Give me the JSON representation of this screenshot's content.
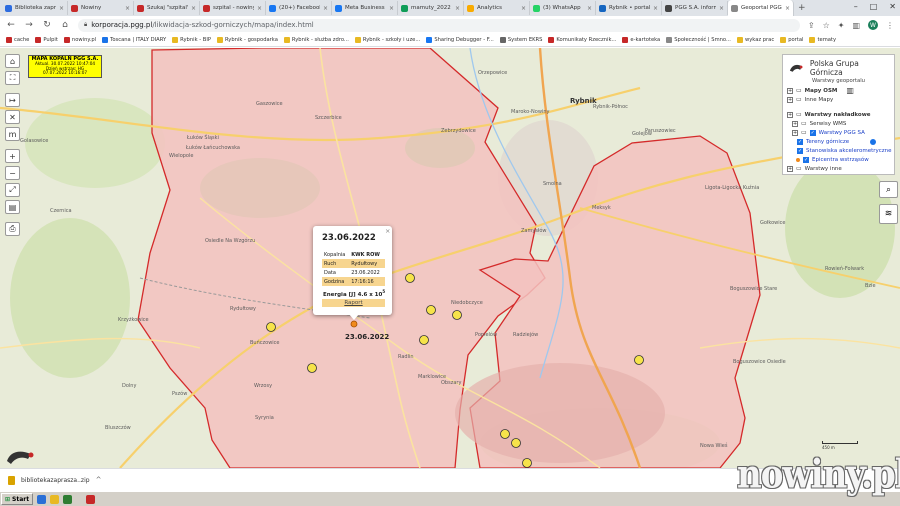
{
  "tabs": [
    {
      "label": "Biblioteka zaprz",
      "color": "#2d6cdf",
      "active": false
    },
    {
      "label": "Nowiny",
      "color": "#c62828",
      "active": false
    },
    {
      "label": "Szukaj \"szpital\"",
      "color": "#c62828",
      "active": false
    },
    {
      "label": "szpital - nowiny",
      "color": "#c62828",
      "active": false
    },
    {
      "label": "(20+) Facebook",
      "color": "#1877f2",
      "active": false
    },
    {
      "label": "Meta Business",
      "color": "#1877f2",
      "active": false
    },
    {
      "label": "mamuty_2022",
      "color": "#0f9d58",
      "active": false
    },
    {
      "label": "Analytics",
      "color": "#f9ab00",
      "active": false
    },
    {
      "label": "(3) WhatsApp",
      "color": "#25d366",
      "active": false
    },
    {
      "label": "Rybnik • portal",
      "color": "#1565c0",
      "active": false
    },
    {
      "label": "PGG S.A. inform",
      "color": "#444444",
      "active": false
    },
    {
      "label": "Geoportal PGG",
      "color": "#888888",
      "active": true
    }
  ],
  "new_tab_icon": "+",
  "window_controls": [
    "–",
    "□",
    "✕"
  ],
  "address": {
    "host": "korporacja.pgg.pl",
    "path": "/likwidacja-szkod-gorniczych/mapa/index.html"
  },
  "profile_initial": "W",
  "bookmarks": [
    {
      "label": "cache",
      "color": "#c62828"
    },
    {
      "label": "Pulpit",
      "color": "#c62828"
    },
    {
      "label": "nowiny.pl",
      "color": "#c62828"
    },
    {
      "label": "Toscana | ITALY DIARY",
      "color": "#1a73e8"
    },
    {
      "label": "Rybnik - BIP",
      "color": "#e8b923"
    },
    {
      "label": "Rybnik - gospodarka",
      "color": "#e8b923"
    },
    {
      "label": "Rybnik - służba zdro...",
      "color": "#e8b923"
    },
    {
      "label": "Rybnik - szkoły i uze...",
      "color": "#e8b923"
    },
    {
      "label": "Sharing Debugger - F...",
      "color": "#1877f2"
    },
    {
      "label": "System EKRS",
      "color": "#666666"
    },
    {
      "label": "Komunikaty Rzecznik...",
      "color": "#c62828"
    },
    {
      "label": "e-kartoteka",
      "color": "#c62828"
    },
    {
      "label": "Społeczność | Smno...",
      "color": "#888888"
    },
    {
      "label": "wykaz prac",
      "color": "#e8b923"
    },
    {
      "label": "portal",
      "color": "#e8b923"
    },
    {
      "label": "tematy",
      "color": "#e8b923"
    }
  ],
  "legend": {
    "title": "MAPA KOPALŃ PGG S.A.",
    "line1": "Aktual. 30.07.2022 10:47:04",
    "line2": "Dzień wstrząs: HG",
    "line3": "07.07.2022 10:16:07"
  },
  "map_tools": [
    "⌂",
    "⛶",
    "↦",
    "✕",
    "m",
    "+",
    "−",
    "⤢",
    "▤",
    "⎙"
  ],
  "panel": {
    "title": "Polska Grupa Górnicza",
    "subtitle": "Warstwy geoportalu",
    "items": [
      {
        "label": "Mapy OSM",
        "bold": true,
        "indent": 0,
        "check": "none",
        "link": false
      },
      {
        "label": "Inne Mapy",
        "bold": false,
        "indent": 0,
        "check": "none",
        "link": false
      },
      {
        "label": "Warstwy nakładkowe",
        "bold": true,
        "indent": 0,
        "check": "none",
        "link": false
      },
      {
        "label": "Serwisy WMS",
        "bold": false,
        "indent": 1,
        "check": "none",
        "link": false
      },
      {
        "label": "Warstwy PGG SA",
        "bold": false,
        "indent": 1,
        "check": "on",
        "link": true
      },
      {
        "label": "Tereny górnicze",
        "bold": false,
        "indent": 2,
        "check": "on",
        "link": true
      },
      {
        "label": "Stanowiska akcelerometryczne",
        "bold": false,
        "indent": 2,
        "check": "on",
        "link": true
      },
      {
        "label": "Epicentra wstrząsów",
        "bold": false,
        "indent": 2,
        "check": "on",
        "link": true
      },
      {
        "label": "Warstwy inne",
        "bold": false,
        "indent": 0,
        "check": "none",
        "link": false
      }
    ]
  },
  "right_tools": {
    "search": "⌕",
    "layers": "≋"
  },
  "popup": {
    "date": "23.06.2022",
    "close": "×",
    "rows": [
      {
        "k": "Kopalnia",
        "v": "KWK ROW",
        "hl": false
      },
      {
        "k": "Ruch",
        "v": "Rydułtowy",
        "hl": true
      },
      {
        "k": "Data",
        "v": "23.06.2022",
        "hl": false
      },
      {
        "k": "Godzina",
        "v": "17:16:16",
        "hl": true
      }
    ],
    "energy_label": "Energia [J]",
    "energy_value": "4.6 x 10",
    "energy_exp": "5",
    "report": "Raport"
  },
  "map_date_label": "23.06.2022",
  "places": [
    "Orzepowice",
    "Zebrzydowice",
    "Golejów",
    "Maroko-Nowiny",
    "Rybnik",
    "Paruszowiec",
    "Szczerbice",
    "Gaszowice",
    "Rybnik-Północ",
    "Zamysłów",
    "Smolna",
    "Meksyk",
    "Ligota-Ligocka Kuźnia",
    "Łuków Śląski",
    "Łuków Łańcuchowska",
    "Wielopole",
    "Osiedle Na Wzgórzu",
    "Niedobczyce",
    "Boguszowice Stare",
    "Rydułtowy",
    "Radlin",
    "Radziejów",
    "Marklowice",
    "Buńczowice",
    "Popielów",
    "Boguszowice Osiedle",
    "Obszary",
    "Wrzosy",
    "Pszów",
    "Syrynia",
    "Bluszczów",
    "Krzyżkowice",
    "Dolny",
    "Gołkowice",
    "Rowień-Folwark",
    "Czernica",
    "Golasowice",
    "Bzie",
    "Nowa Wieś"
  ],
  "panel_logo": "pgg-logo",
  "scale": {
    "label1": "450 m",
    "label2": "0.5 km"
  },
  "download": {
    "file": "bibliotekazaprasza..zip",
    "caret": "^"
  },
  "taskbar": {
    "start": "Start"
  },
  "watermark": "nowiny.pl"
}
